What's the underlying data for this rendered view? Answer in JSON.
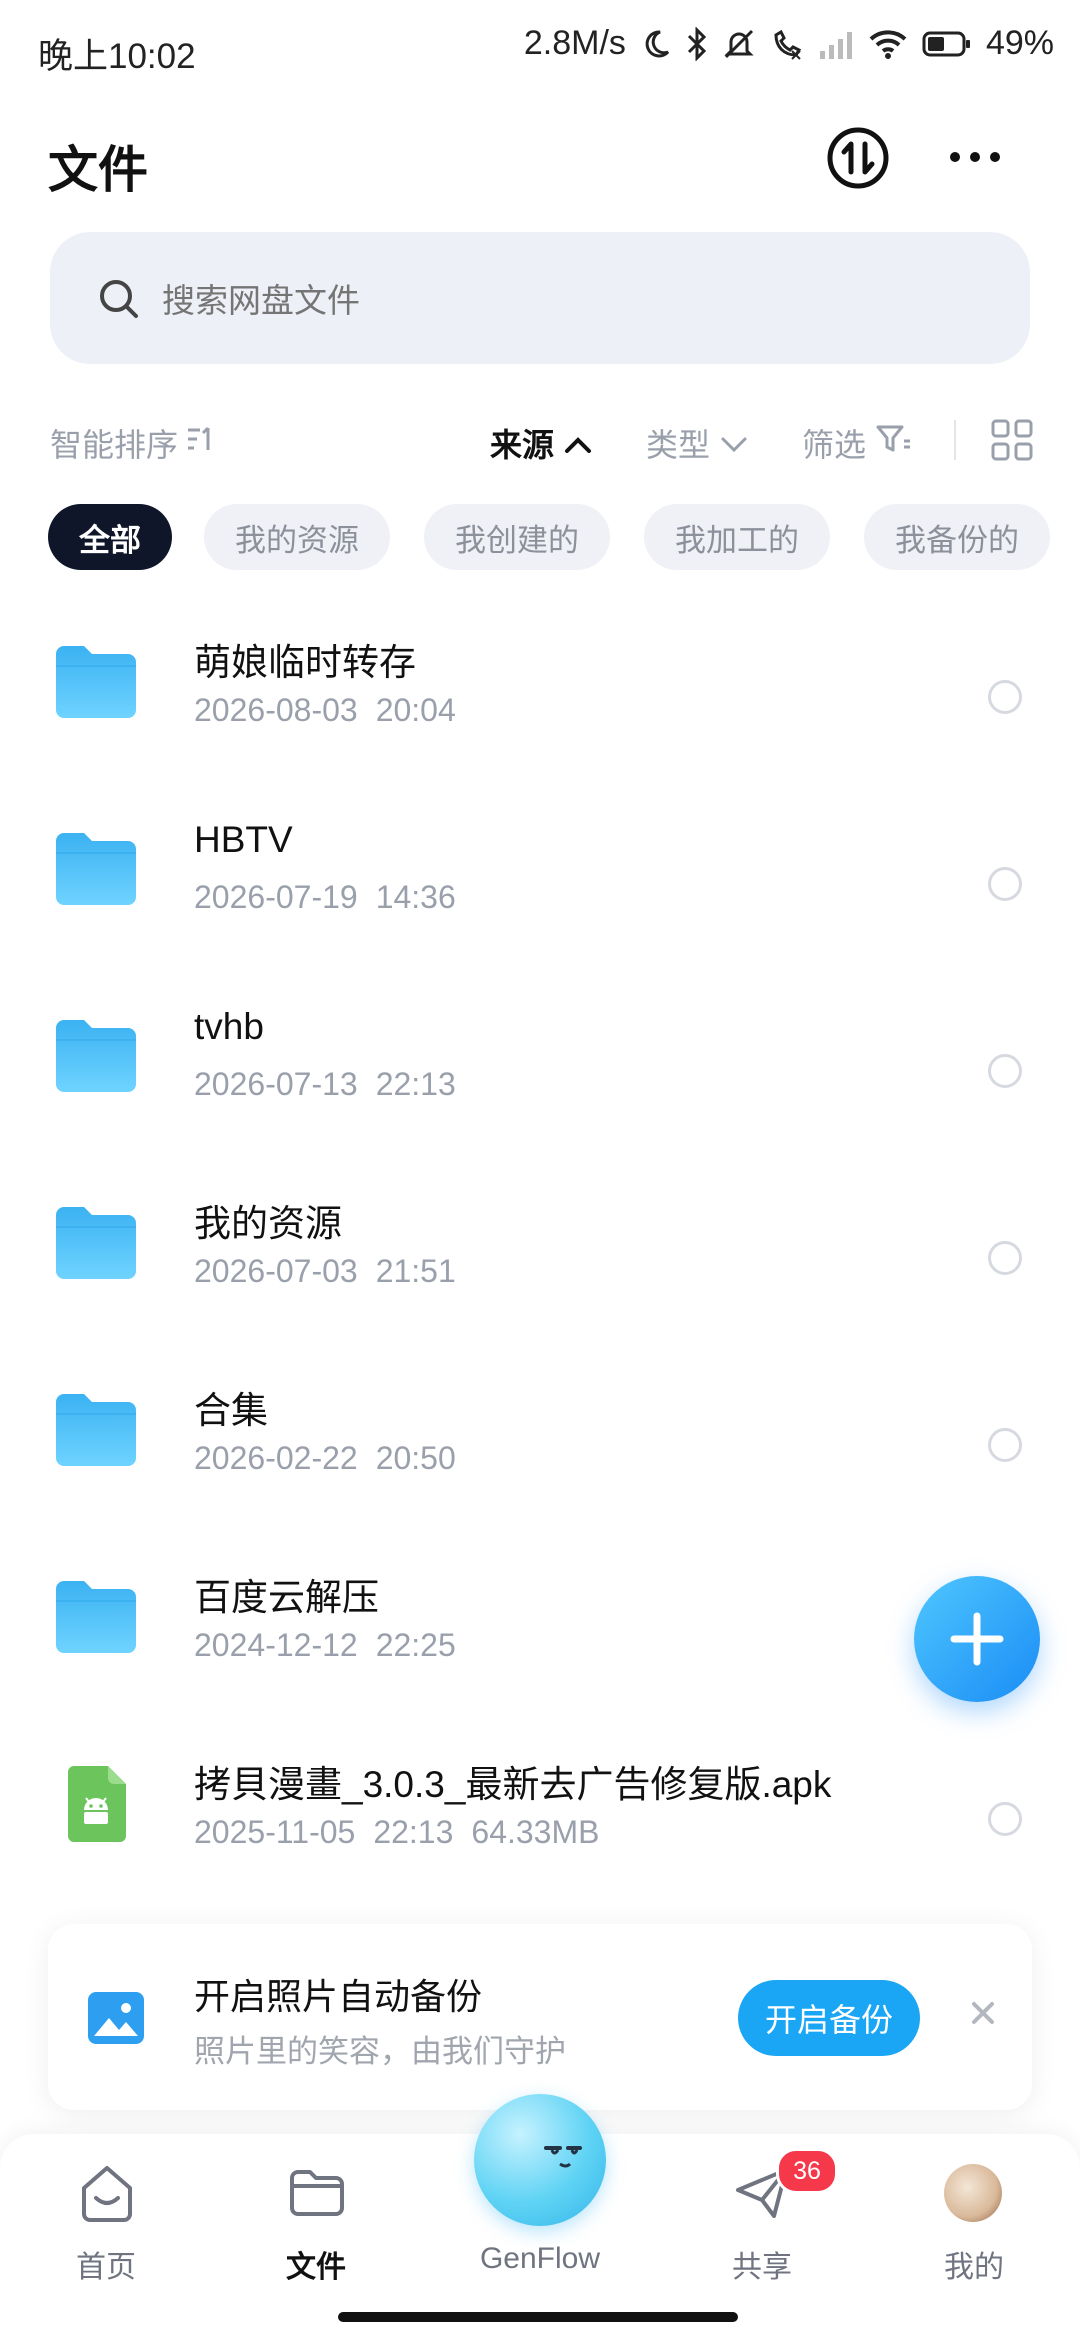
{
  "status_bar": {
    "time": "晚上10:02",
    "net_speed": "2.8M/s",
    "battery": "49%",
    "battery_level": 0.49
  },
  "header": {
    "title": "文件",
    "transfer_icon": "transfer-icon",
    "more_icon": "more-icon"
  },
  "search": {
    "placeholder": "搜索网盘文件"
  },
  "sort": {
    "smart_sort": "智能排序",
    "source": "来源",
    "type": "类型",
    "filter": "筛选"
  },
  "chips": [
    "全部",
    "我的资源",
    "我创建的",
    "我加工的",
    "我备份的"
  ],
  "files": [
    {
      "name": "萌娘临时转存",
      "date": "2026-08-03",
      "time": "20:04",
      "size": "",
      "kind": "folder"
    },
    {
      "name": "HBTV",
      "date": "2026-07-19",
      "time": "14:36",
      "size": "",
      "kind": "folder"
    },
    {
      "name": "tvhb",
      "date": "2026-07-13",
      "time": "22:13",
      "size": "",
      "kind": "folder"
    },
    {
      "name": "我的资源",
      "date": "2026-07-03",
      "time": "21:51",
      "size": "",
      "kind": "folder"
    },
    {
      "name": "合集",
      "date": "2026-02-22",
      "time": "20:50",
      "size": "",
      "kind": "folder"
    },
    {
      "name": "百度云解压",
      "date": "2024-12-12",
      "time": "22:25",
      "size": "",
      "kind": "folder"
    },
    {
      "name": "拷貝漫畫_3.0.3_最新去广告修复版.apk",
      "date": "2025-11-05",
      "time": "22:13",
      "size": "64.33MB",
      "kind": "apk"
    }
  ],
  "banner": {
    "title": "开启照片自动备份",
    "subtitle": "照片里的笑容，由我们守护",
    "button": "开启备份"
  },
  "nav": {
    "items": [
      {
        "label": "首页"
      },
      {
        "label": "文件"
      },
      {
        "label": "GenFlow"
      },
      {
        "label": "共享"
      },
      {
        "label": "我的"
      }
    ],
    "share_badge": "36"
  },
  "colors": {
    "accent": "#1aa6f5",
    "folder": "#3db9f5",
    "chip_active": "#0f1629",
    "badge": "#f5384a"
  }
}
